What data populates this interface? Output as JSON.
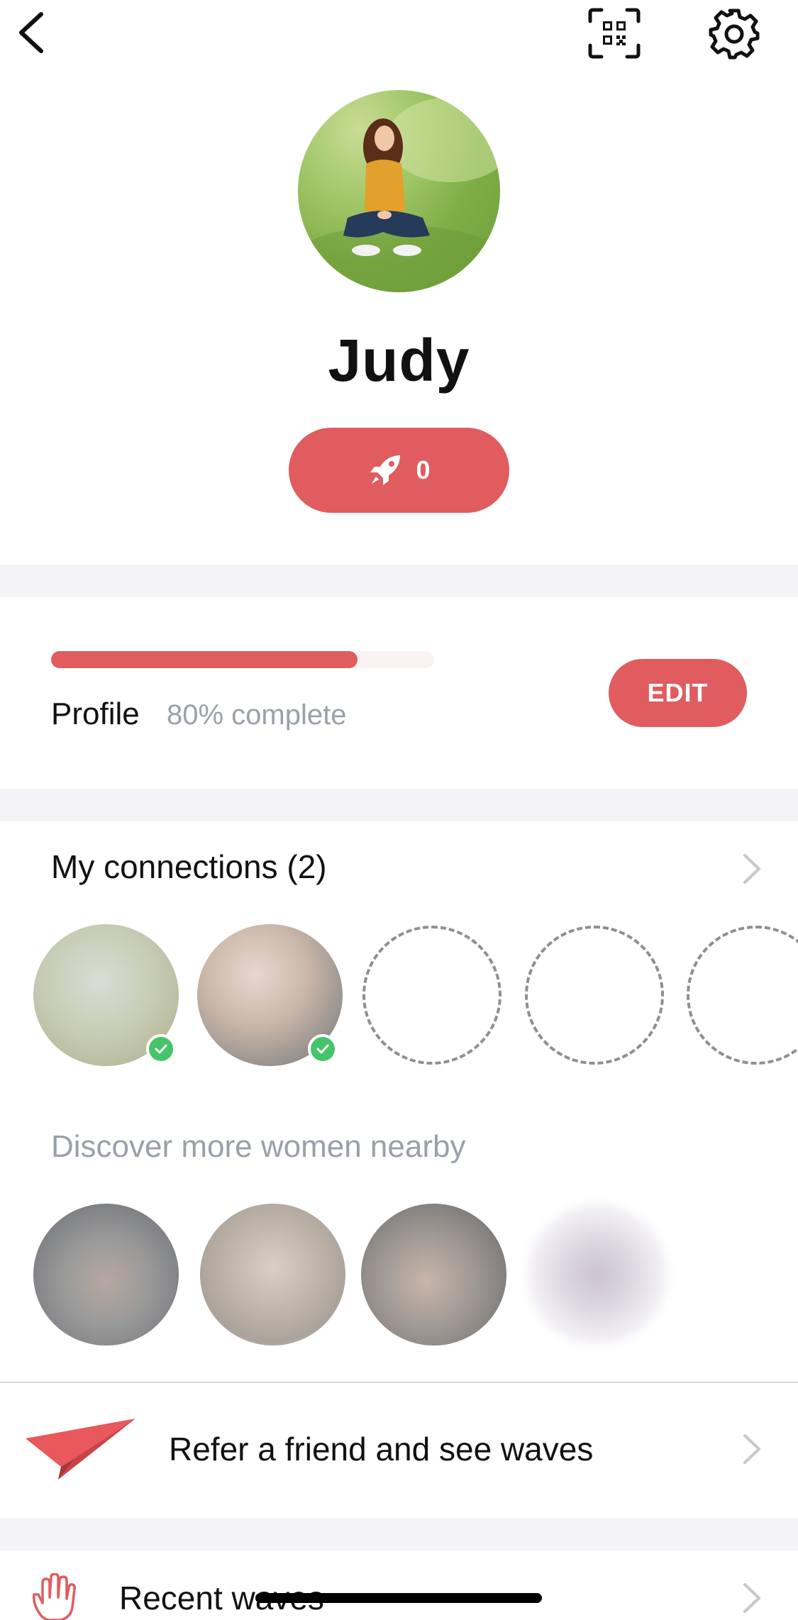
{
  "profile": {
    "name": "Judy",
    "boost_count": "0"
  },
  "completion": {
    "label": "Profile",
    "percent_text": "80% complete",
    "fraction": 0.8,
    "edit_label": "EDIT"
  },
  "connections": {
    "title": "My connections (2)",
    "count": 2
  },
  "discover": {
    "title": "Discover more women nearby"
  },
  "refer": {
    "label": "Refer a friend and see waves"
  },
  "waves": {
    "label": "Recent waves"
  },
  "colors": {
    "accent": "#e05c5f",
    "muted_text": "#9aa0aa",
    "check": "#45c46a"
  },
  "icons": [
    "back-arrow-icon",
    "qr-code-icon",
    "gear-icon",
    "rocket-icon",
    "check-icon",
    "chevron-right-icon",
    "paper-plane-icon",
    "hand-wave-icon"
  ]
}
